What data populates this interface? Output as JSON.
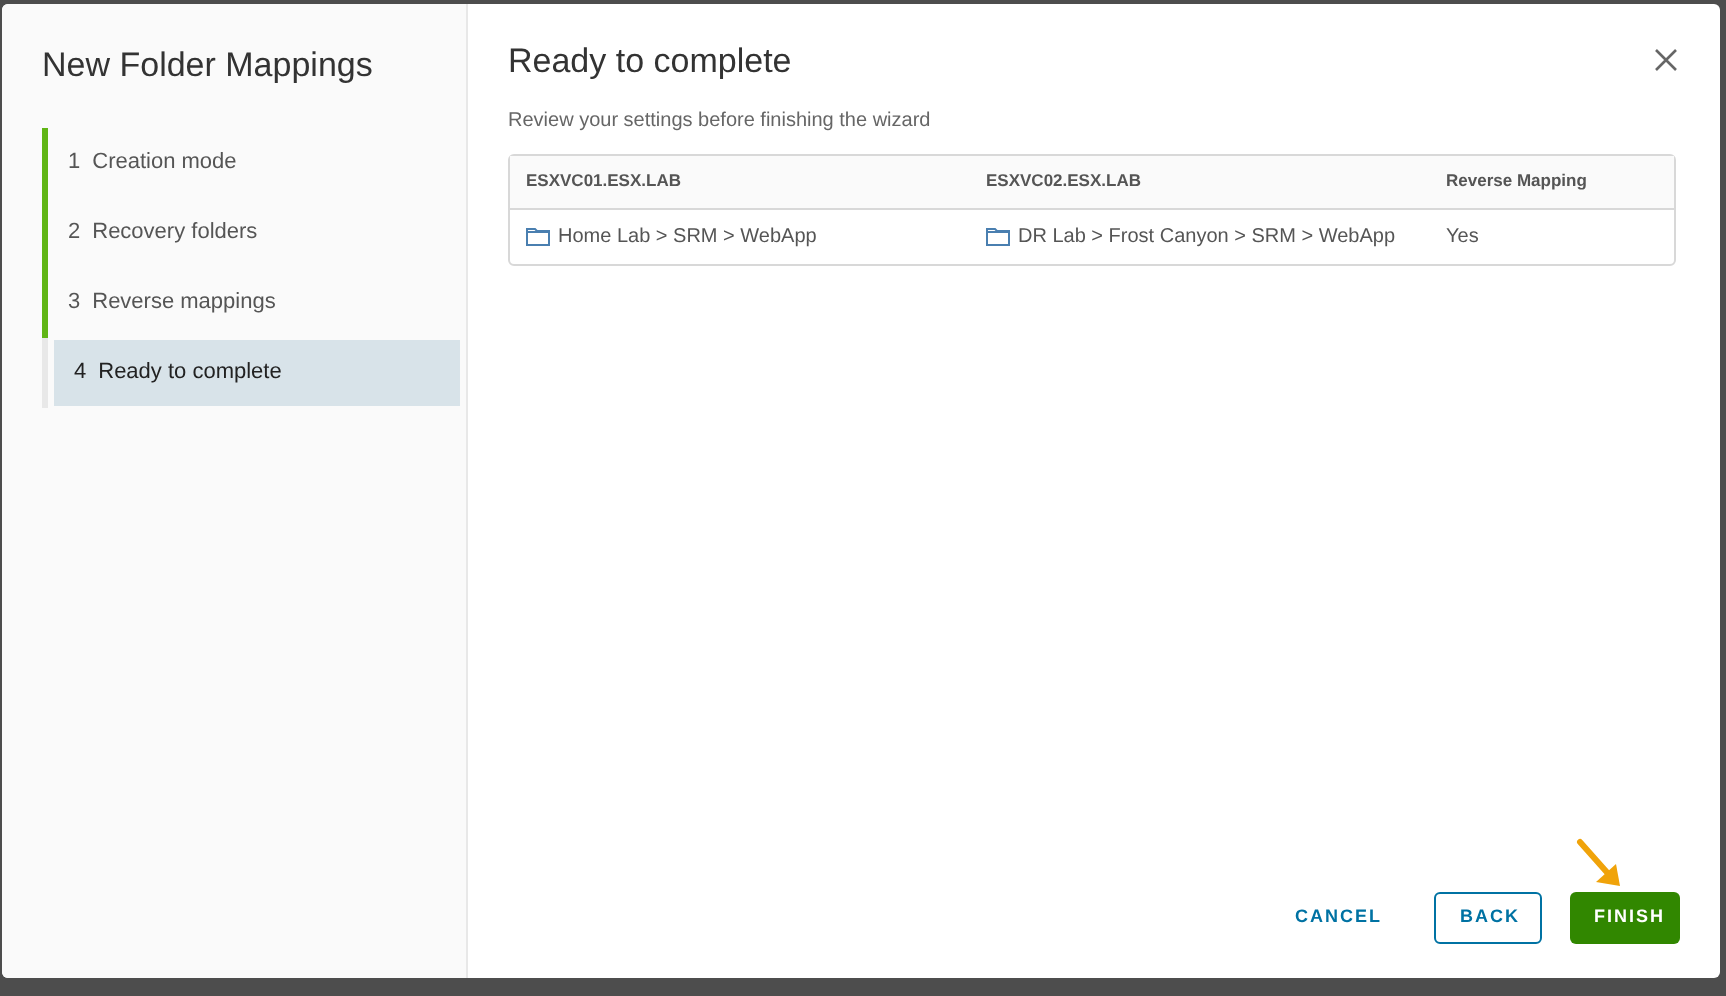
{
  "wizard": {
    "title": "New Folder Mappings",
    "steps": [
      {
        "number": "1",
        "label": "Creation mode",
        "completed": true,
        "selected": false
      },
      {
        "number": "2",
        "label": "Recovery folders",
        "completed": true,
        "selected": false
      },
      {
        "number": "3",
        "label": "Reverse mappings",
        "completed": true,
        "selected": false
      },
      {
        "number": "4",
        "label": "Ready to complete",
        "completed": false,
        "selected": true
      }
    ]
  },
  "page": {
    "title": "Ready to complete",
    "subtitle": "Review your settings before finishing the wizard"
  },
  "table": {
    "columns": [
      "ESXVC01.ESX.LAB",
      "ESXVC02.ESX.LAB",
      "Reverse Mapping"
    ],
    "rows": [
      {
        "source": "Home Lab > SRM > WebApp",
        "target": "DR Lab > Frost Canyon > SRM > WebApp",
        "reverse": "Yes"
      }
    ]
  },
  "buttons": [
    {
      "label": "CANCEL",
      "kind": "link"
    },
    {
      "label": "BACK",
      "kind": "outline"
    },
    {
      "label": "FINISH",
      "kind": "primary"
    }
  ]
}
